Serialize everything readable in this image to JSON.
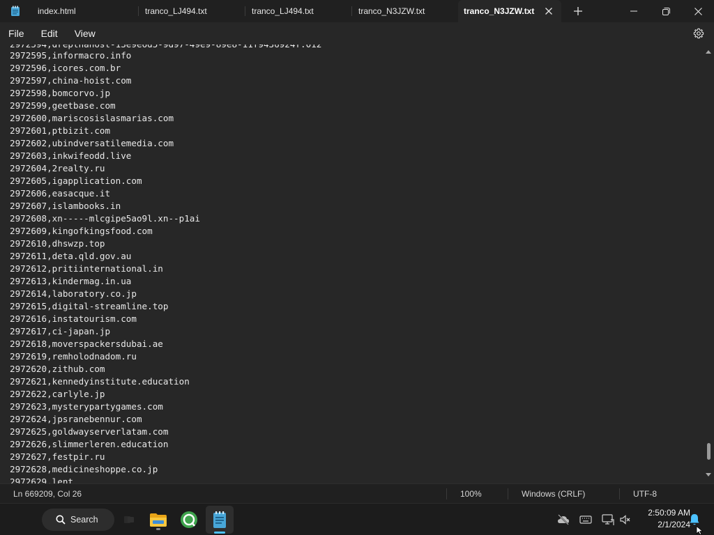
{
  "tabs": [
    {
      "label": "index.html"
    },
    {
      "label": "tranco_LJ494.txt"
    },
    {
      "label": "tranco_LJ494.txt"
    },
    {
      "label": "tranco_N3JZW.txt"
    },
    {
      "label": "tranco_N3JZW.txt"
    }
  ],
  "menu": {
    "file": "File",
    "edit": "Edit",
    "view": "View"
  },
  "editor": {
    "partial_top": "2972594,dreptnahost-13e9e6d5-9d97-49e9-89e8-11f9436924f.012",
    "lines": [
      "2972595,informacro.info",
      "2972596,icores.com.br",
      "2972597,china-hoist.com",
      "2972598,bomcorvo.jp",
      "2972599,geetbase.com",
      "2972600,mariscosislasmarias.com",
      "2972601,ptbizit.com",
      "2972602,ubindversatilemedia.com",
      "2972603,inkwifeodd.live",
      "2972604,2realty.ru",
      "2972605,igapplication.com",
      "2972606,easacque.it",
      "2972607,islambooks.in",
      "2972608,xn-----mlcgipe5ao9l.xn--p1ai",
      "2972609,kingofkingsfood.com",
      "2972610,dhswzp.top",
      "2972611,deta.qld.gov.au",
      "2972612,pritiinternational.in",
      "2972613,kindermag.in.ua",
      "2972614,laboratory.co.jp",
      "2972615,digital-streamline.top",
      "2972616,instatourism.com",
      "2972617,ci-japan.jp",
      "2972618,moverspackersdubai.ae",
      "2972619,remholodnadom.ru",
      "2972620,zithub.com",
      "2972621,kennedyinstitute.education",
      "2972622,carlyle.jp",
      "2972623,mysterypartygames.com",
      "2972624,jpsranebennur.com",
      "2972625,goldwayserverlatam.com",
      "2972626,slimmerleren.education",
      "2972627,festpir.ru",
      "2972628,medicineshoppe.co.jp"
    ],
    "partial_bottom": "2972629,lent..."
  },
  "status": {
    "position": "Ln 669209, Col 26",
    "zoom": "100%",
    "line_ending": "Windows (CRLF)",
    "encoding": "UTF-8"
  },
  "taskbar": {
    "search_label": "Search",
    "time": "2:50:09 AM",
    "date": "2/1/2024"
  },
  "colors": {
    "accent": "#4cc2ff",
    "editor_bg": "#272727",
    "tab_bg": "#202020"
  }
}
